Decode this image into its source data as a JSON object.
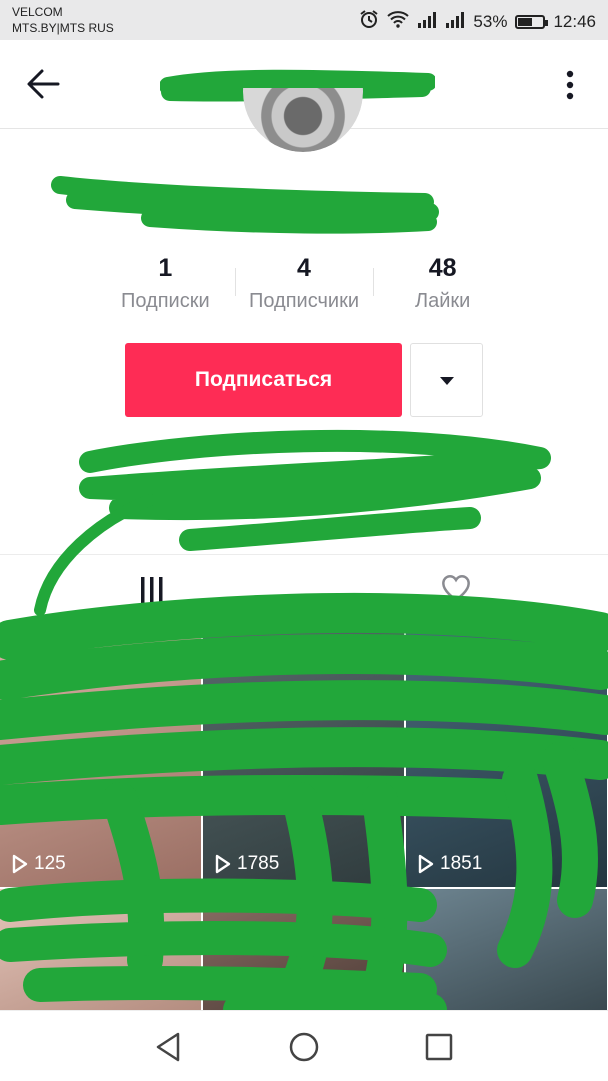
{
  "status_bar": {
    "carrier_1": "VELCOM",
    "carrier_2": "MTS.BY|MTS RUS",
    "battery": "53%",
    "time": "12:46",
    "icons": [
      "alarm-icon",
      "wifi-icon",
      "signal-icon",
      "signal-icon",
      "battery-icon"
    ]
  },
  "header": {
    "back_icon": "arrow-left-icon",
    "more_icon": "more-vertical-icon"
  },
  "stats": [
    {
      "value": "1",
      "label": "Подписки"
    },
    {
      "value": "4",
      "label": "Подписчики"
    },
    {
      "value": "48",
      "label": "Лайки"
    }
  ],
  "actions": {
    "follow_label": "Подписаться",
    "dropdown_icon": "caret-down-icon"
  },
  "tabs": [
    {
      "icon": "grid-icon"
    },
    {
      "icon": "heart-icon"
    }
  ],
  "videos": [
    {
      "views": "125"
    },
    {
      "views": "1785"
    },
    {
      "views": "1851"
    }
  ],
  "navbar": {
    "icons": [
      "back-triangle-icon",
      "home-circle-icon",
      "recents-square-icon"
    ]
  },
  "colors": {
    "accent": "#fe2c55",
    "scribble": "#22a73a",
    "status_bar": "#e9e9ea"
  }
}
